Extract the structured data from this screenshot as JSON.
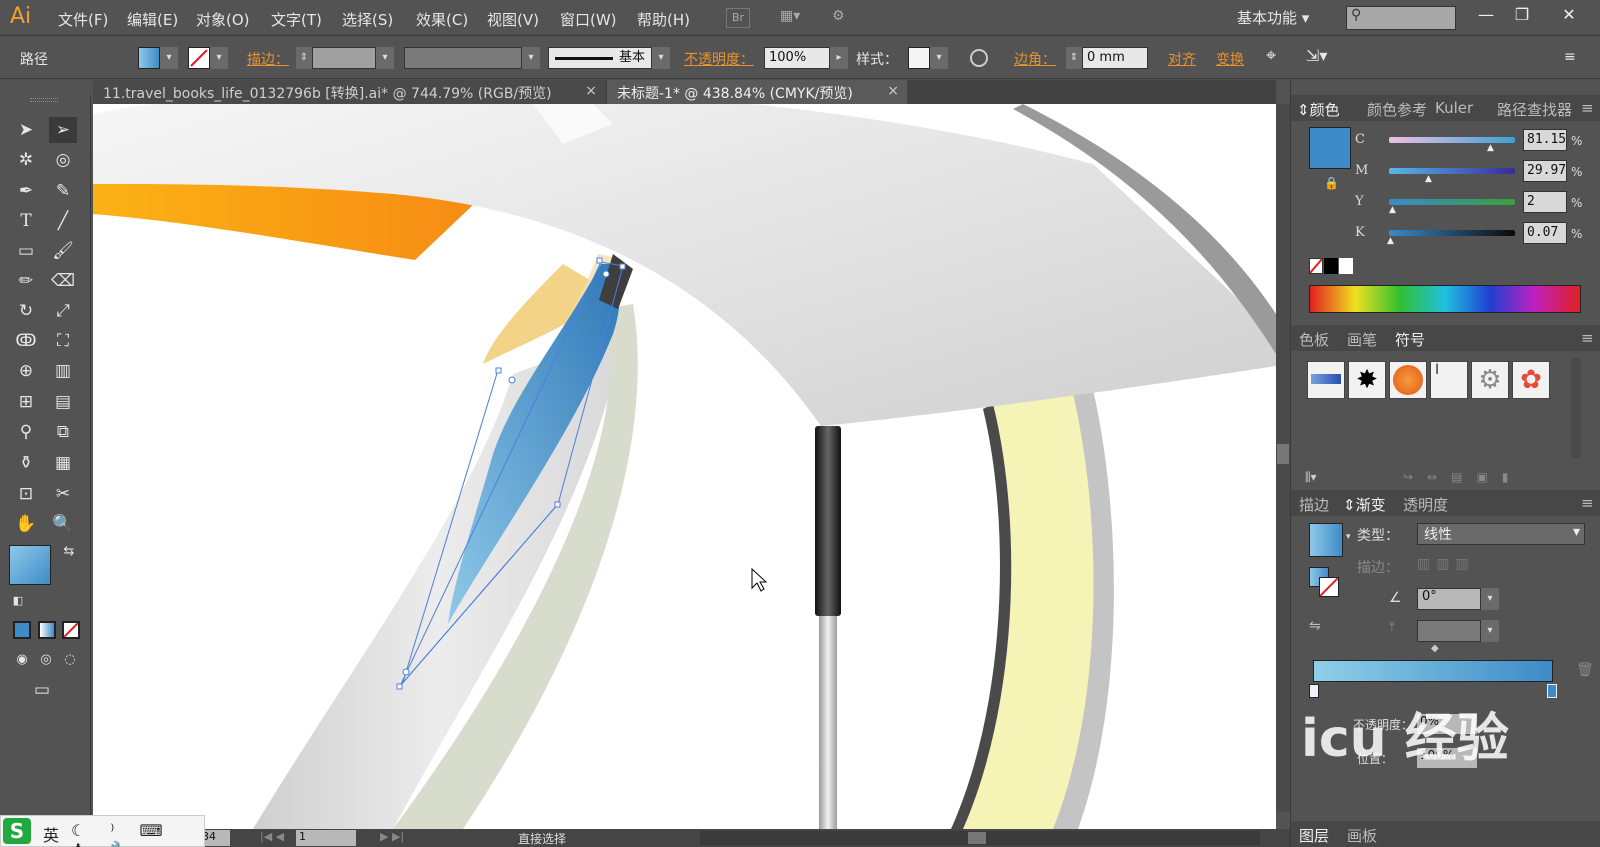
{
  "app": {
    "logo": "Ai",
    "menu": [
      "文件(F)",
      "编辑(E)",
      "对象(O)",
      "文字(T)",
      "选择(S)",
      "效果(C)",
      "视图(V)",
      "窗口(W)",
      "帮助(H)"
    ],
    "br_label": "Br",
    "workspace": "基本功能",
    "window_controls": [
      "—",
      "❐",
      "✕"
    ]
  },
  "control_bar": {
    "object_type": "路径",
    "stroke_label": "描边：",
    "stroke_style": "基本",
    "opacity_label": "不透明度：",
    "opacity_value": "100%",
    "style_label": "样式：",
    "corner_label": "边角：",
    "corner_value": "0 mm",
    "align_label": "对齐",
    "transform_label": "变换"
  },
  "tabs": [
    {
      "label": "11.travel_books_life_0132796b  [转换].ai* @ 744.79% (RGB/预览)",
      "close": "×",
      "active": false
    },
    {
      "label": "未标题-1* @ 438.84% (CMYK/预览)",
      "close": "×",
      "active": true
    }
  ],
  "status": {
    "zoom": "34",
    "artboard": "1",
    "tool_name": "直接选择"
  },
  "color_panel": {
    "tabs": [
      "颜色",
      "颜色参考",
      "Kuler",
      "路径查找器"
    ],
    "swatch_color": "#3d8bc8",
    "channels": [
      {
        "name": "C",
        "value": "81.15",
        "pos": 0.81
      },
      {
        "name": "M",
        "value": "29.97",
        "pos": 0.3
      },
      {
        "name": "Y",
        "value": "2",
        "pos": 0.02
      },
      {
        "name": "K",
        "value": "0.07",
        "pos": 0.01
      }
    ],
    "percent": "%"
  },
  "symbol_panel": {
    "tabs": [
      "色板",
      "画笔",
      "符号"
    ]
  },
  "gradient_panel": {
    "tabs": [
      "描边",
      "渐变",
      "透明度"
    ],
    "type_label": "类型：",
    "type_value": "线性",
    "stroke_label": "描边：",
    "angle_value": "0°",
    "location_label": "位置：",
    "location_value": "100%",
    "opacity_label": "不透明度：",
    "opacity_value": "0%"
  },
  "layers_panel": {
    "tabs": [
      "图层",
      "画板"
    ]
  },
  "ime": {
    "lang": "英"
  },
  "watermark": "icu 经验"
}
